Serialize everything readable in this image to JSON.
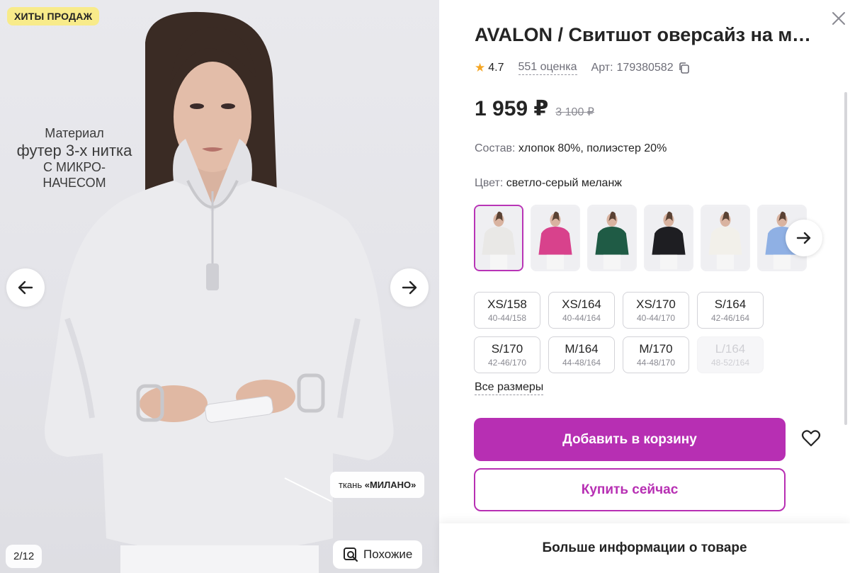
{
  "gallery": {
    "badge": "ХИТЫ ПРОДАЖ",
    "overlay": {
      "line1": "Материал",
      "line2": "футер 3-х нитка",
      "line3": "с микро-",
      "line4": "начесом"
    },
    "fabric_prefix": "ткань ",
    "fabric_name": "«МИЛАНО»",
    "counter": "2/12",
    "similar_label": "Похожие",
    "icons": {
      "prev": "arrow-left-icon",
      "next": "arrow-right-icon",
      "similar": "image-search-icon"
    }
  },
  "product": {
    "title": "AVALON / Свитшот оверсайз на молнии",
    "rating": "4.7",
    "reviews": "551 оценка",
    "article_label": "Арт:",
    "article": "179380582",
    "price": "1 959 ₽",
    "old_price": "3 100 ₽",
    "composition_label": "Состав:",
    "composition": "хлопок 80%, полиэстер 20%",
    "color_label": "Цвет:",
    "color": "светло-серый меланж",
    "swatches": [
      {
        "name": "светло-серый",
        "color": "#e9e8e6",
        "selected": true
      },
      {
        "name": "розовый",
        "color": "#d8428c"
      },
      {
        "name": "зелёный",
        "color": "#1f5b45"
      },
      {
        "name": "чёрный",
        "color": "#1e1e22"
      },
      {
        "name": "молочный",
        "color": "#f2f0ea"
      },
      {
        "name": "голубой",
        "color": "#8fb0e4"
      }
    ],
    "sizes": [
      {
        "size": "XS/158",
        "range": "40-44/158",
        "available": true
      },
      {
        "size": "XS/164",
        "range": "40-44/164",
        "available": true
      },
      {
        "size": "XS/170",
        "range": "40-44/170",
        "available": true
      },
      {
        "size": "S/164",
        "range": "42-46/164",
        "available": true
      },
      {
        "size": "S/170",
        "range": "42-46/170",
        "available": true
      },
      {
        "size": "M/164",
        "range": "44-48/164",
        "available": true
      },
      {
        "size": "M/170",
        "range": "44-48/170",
        "available": true
      },
      {
        "size": "L/164",
        "range": "48-52/164",
        "available": false
      }
    ],
    "all_sizes": "Все размеры",
    "add_to_cart": "Добавить в корзину",
    "buy_now": "Купить сейчас",
    "more_info": "Больше информации о товаре"
  },
  "colors": {
    "accent": "#b72fb3",
    "badge": "#f8eb8a",
    "star": "#f5a623"
  }
}
